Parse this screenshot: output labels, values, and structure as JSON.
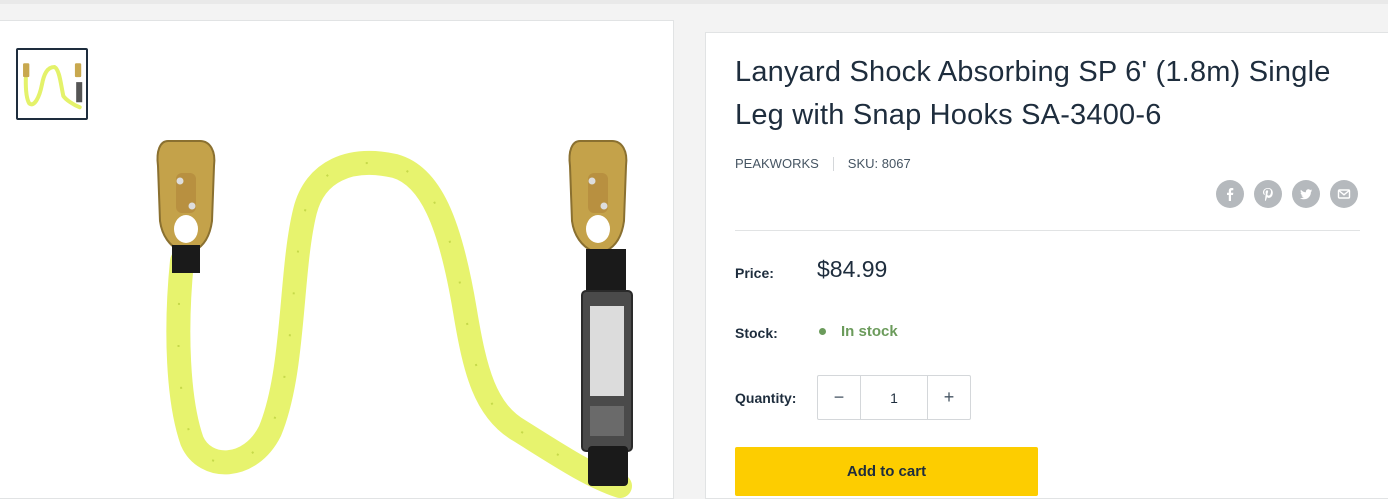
{
  "product": {
    "title": "Lanyard Shock Absorbing SP 6' (1.8m) Single Leg with Snap Hooks SA-3400-6",
    "vendor": "PEAKWORKS",
    "sku": "SKU: 8067"
  },
  "labels": {
    "price": "Price:",
    "stock": "Stock:",
    "quantity": "Quantity:"
  },
  "price": "$84.99",
  "stock_status": "In stock",
  "quantity": {
    "value": "1",
    "decrease": "−",
    "increase": "+"
  },
  "add_to_cart": "Add to cart",
  "share_icons": [
    "facebook-icon",
    "pinterest-icon",
    "twitter-icon",
    "email-icon"
  ],
  "colors": {
    "accent": "#fdcd00",
    "in_stock": "#6b9b5b",
    "text": "#1e2d3d",
    "share_icon_bg": "#b5b9bd"
  }
}
